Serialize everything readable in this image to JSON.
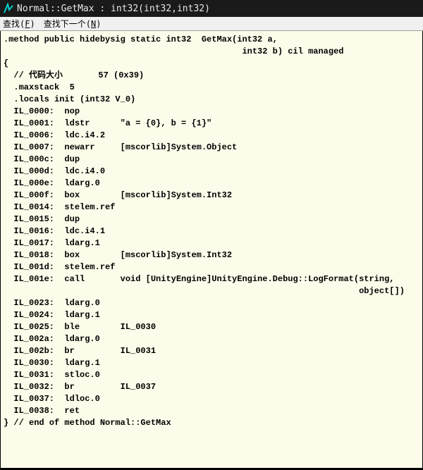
{
  "titlebar": {
    "title": "Normal::GetMax : int32(int32,int32)"
  },
  "menubar": {
    "find": {
      "label": "查找",
      "accel": "F"
    },
    "findNext": {
      "label": "查找下一个",
      "accel": "N"
    }
  },
  "code": {
    "l00": ".method public hidebysig static int32  GetMax(int32 a,",
    "l01": "                                               int32 b) cil managed",
    "l02": "{",
    "l03": "  // 代码大小       57 (0x39)",
    "l04": "  .maxstack  5",
    "l05": "  .locals init (int32 V_0)",
    "l06": "  IL_0000:  nop",
    "l07": "  IL_0001:  ldstr      \"a = {0}, b = {1}\"",
    "l08": "  IL_0006:  ldc.i4.2",
    "l09": "  IL_0007:  newarr     [mscorlib]System.Object",
    "l10": "  IL_000c:  dup",
    "l11": "  IL_000d:  ldc.i4.0",
    "l12": "  IL_000e:  ldarg.0",
    "l13": "  IL_000f:  box        [mscorlib]System.Int32",
    "l14": "  IL_0014:  stelem.ref",
    "l15": "  IL_0015:  dup",
    "l16": "  IL_0016:  ldc.i4.1",
    "l17": "  IL_0017:  ldarg.1",
    "l18": "  IL_0018:  box        [mscorlib]System.Int32",
    "l19": "  IL_001d:  stelem.ref",
    "l20": "  IL_001e:  call       void [UnityEngine]UnityEngine.Debug::LogFormat(string,",
    "l21": "                                                                      object[])",
    "l22": "  IL_0023:  ldarg.0",
    "l23": "  IL_0024:  ldarg.1",
    "l24": "  IL_0025:  ble        IL_0030",
    "l25": "  IL_002a:  ldarg.0",
    "l26": "  IL_002b:  br         IL_0031",
    "l27": "  IL_0030:  ldarg.1",
    "l28": "  IL_0031:  stloc.0",
    "l29": "  IL_0032:  br         IL_0037",
    "l30": "  IL_0037:  ldloc.0",
    "l31": "  IL_0038:  ret",
    "l32": "} // end of method Normal::GetMax"
  }
}
